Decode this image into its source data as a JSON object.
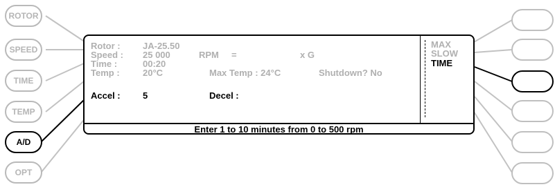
{
  "left_keys": [
    {
      "label": "ROTOR",
      "active": false
    },
    {
      "label": "SPEED",
      "active": false
    },
    {
      "label": "TIME",
      "active": false
    },
    {
      "label": "TEMP",
      "active": false
    },
    {
      "label": "A/D",
      "active": true
    },
    {
      "label": "OPT",
      "active": false
    }
  ],
  "right_keys_active_index": 2,
  "screen": {
    "rotor_label": "Rotor :",
    "rotor_value": "JA-25.50",
    "speed_label": "Speed :",
    "speed_value": "25 000",
    "speed_unit": "RPM",
    "speed_equals": "=",
    "speed_g": "x G",
    "time_label": "Time :",
    "time_value": "00:20",
    "temp_label": "Temp :",
    "temp_value": "20°C",
    "max_temp": "Max Temp : 24°C",
    "shutdown": "Shutdown? No",
    "accel_label": "Accel :",
    "accel_value": "5",
    "decel_label": "Decel :",
    "message": "Enter 1 to 10 minutes from 0 to 500 rpm"
  },
  "menu": {
    "max": "MAX",
    "slow": "SLOW",
    "time": "TIME"
  },
  "colors": {
    "inactive": "#b5b5b5",
    "active": "#000000"
  }
}
